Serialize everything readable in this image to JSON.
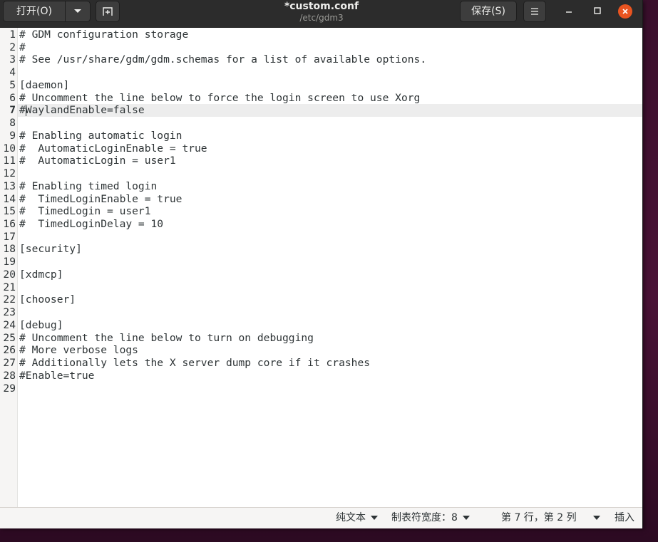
{
  "header": {
    "open_label": "打开(O)",
    "title": "*custom.conf",
    "subtitle": "/etc/gdm3",
    "save_label": "保存(S)"
  },
  "icons": {
    "open_menu": "chevron-down-icon",
    "new_tab": "new-document-icon",
    "menu": "hamburger-menu-icon",
    "minimize": "minimize-icon",
    "maximize": "maximize-icon",
    "close": "close-icon"
  },
  "colors": {
    "headerbar": "#2c2c2c",
    "close_button": "#e95420",
    "current_line": "#ededed"
  },
  "editor": {
    "current_line": 7,
    "lines": [
      {
        "n": "1",
        "text": "# GDM configuration storage"
      },
      {
        "n": "2",
        "text": "#"
      },
      {
        "n": "3",
        "text": "# See /usr/share/gdm/gdm.schemas for a list of available options."
      },
      {
        "n": "4",
        "text": ""
      },
      {
        "n": "5",
        "text": "[daemon]"
      },
      {
        "n": "6",
        "text": "# Uncomment the line below to force the login screen to use Xorg"
      },
      {
        "n": "7",
        "text": "#WaylandEnable=false"
      },
      {
        "n": "8",
        "text": ""
      },
      {
        "n": "9",
        "text": "# Enabling automatic login"
      },
      {
        "n": "10",
        "text": "#  AutomaticLoginEnable = true"
      },
      {
        "n": "11",
        "text": "#  AutomaticLogin = user1"
      },
      {
        "n": "12",
        "text": ""
      },
      {
        "n": "13",
        "text": "# Enabling timed login"
      },
      {
        "n": "14",
        "text": "#  TimedLoginEnable = true"
      },
      {
        "n": "15",
        "text": "#  TimedLogin = user1"
      },
      {
        "n": "16",
        "text": "#  TimedLoginDelay = 10"
      },
      {
        "n": "17",
        "text": ""
      },
      {
        "n": "18",
        "text": "[security]"
      },
      {
        "n": "19",
        "text": ""
      },
      {
        "n": "20",
        "text": "[xdmcp]"
      },
      {
        "n": "21",
        "text": ""
      },
      {
        "n": "22",
        "text": "[chooser]"
      },
      {
        "n": "23",
        "text": ""
      },
      {
        "n": "24",
        "text": "[debug]"
      },
      {
        "n": "25",
        "text": "# Uncomment the line below to turn on debugging"
      },
      {
        "n": "26",
        "text": "# More verbose logs"
      },
      {
        "n": "27",
        "text": "# Additionally lets the X server dump core if it crashes"
      },
      {
        "n": "28",
        "text": "#Enable=true"
      },
      {
        "n": "29",
        "text": ""
      }
    ]
  },
  "statusbar": {
    "language": "纯文本",
    "tab_width": "制表符宽度：8",
    "position": "第 7 行，第 2 列",
    "insert_mode": "插入"
  }
}
